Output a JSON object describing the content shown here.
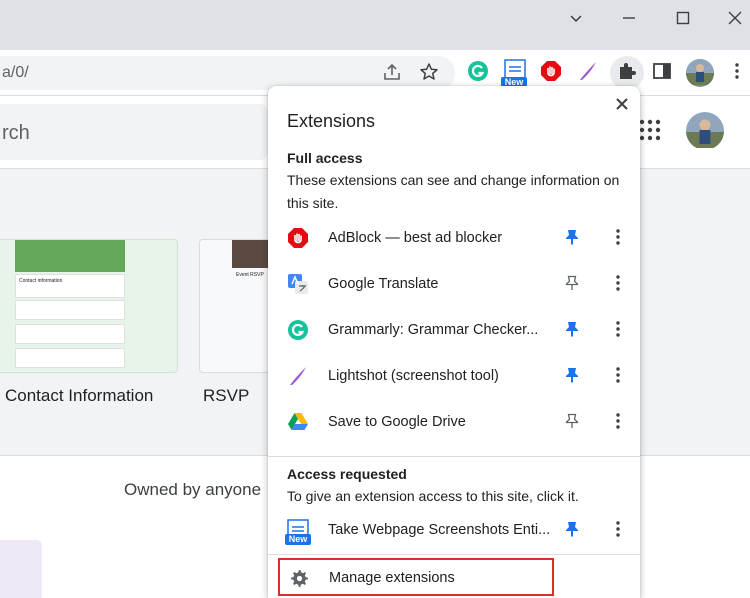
{
  "browser": {
    "url_fragment": "a/0/",
    "new_badge": "New",
    "window_controls": [
      "chevron-down-icon",
      "minimize-icon",
      "maximize-icon",
      "close-icon"
    ]
  },
  "page": {
    "search_placeholder_fragment": "rch",
    "templates": [
      {
        "label": "Contact Information",
        "thumb_title": "Contact information"
      },
      {
        "label": "RSVP",
        "thumb_title": "Event RSVP"
      }
    ],
    "owned_by": "Owned by anyone"
  },
  "extensions_popup": {
    "title": "Extensions",
    "full_access": {
      "heading": "Full access",
      "description": "These extensions can see and change information on this site.",
      "items": [
        {
          "name": "AdBlock — best ad blocker",
          "pinned": true,
          "icon": "adblock-icon"
        },
        {
          "name": "Google Translate",
          "pinned": false,
          "icon": "google-translate-icon"
        },
        {
          "name": "Grammarly: Grammar Checker...",
          "pinned": true,
          "icon": "grammarly-icon"
        },
        {
          "name": "Lightshot (screenshot tool)",
          "pinned": true,
          "icon": "lightshot-icon"
        },
        {
          "name": "Save to Google Drive",
          "pinned": false,
          "icon": "google-drive-icon"
        }
      ]
    },
    "access_requested": {
      "heading": "Access requested",
      "description": "To give an extension access to this site, click it.",
      "items": [
        {
          "name": "Take Webpage Screenshots Enti...",
          "pinned": true,
          "icon": "webpage-screenshot-icon",
          "badge": "New"
        }
      ]
    },
    "manage_label": "Manage extensions"
  },
  "colors": {
    "accent_blue": "#1a73e8",
    "highlight_red": "#d93025",
    "grammarly_green": "#15c39a",
    "adblock_red": "#e40c12"
  }
}
